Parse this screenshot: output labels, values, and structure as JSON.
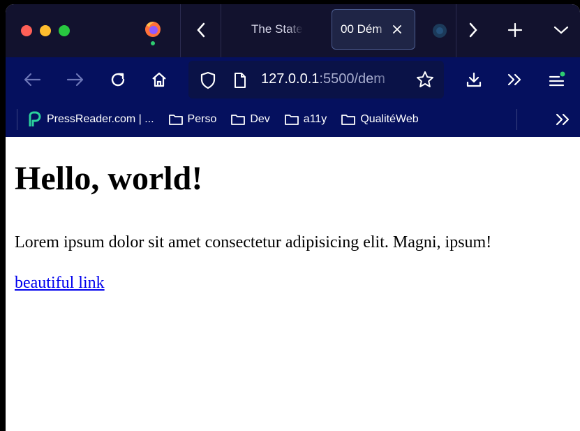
{
  "browser": {
    "tabs": [
      {
        "title": "The State",
        "active": false
      },
      {
        "title": "00 Dém",
        "active": true
      }
    ],
    "url": {
      "host": "127.0.0.1",
      "rest": ":5500/dem"
    },
    "bookmarks": [
      {
        "label": "PressReader.com | ...",
        "icon": "pressreader-icon"
      },
      {
        "label": "Perso",
        "icon": "folder-icon"
      },
      {
        "label": "Dev",
        "icon": "folder-icon"
      },
      {
        "label": "a11y",
        "icon": "folder-icon"
      },
      {
        "label": "QualitéWeb",
        "icon": "folder-icon"
      }
    ],
    "colors": {
      "tabbar": "#12122e",
      "navbar": "#05105e",
      "accent": "#2ecc71"
    }
  },
  "page": {
    "heading": "Hello, world!",
    "paragraph": "Lorem ipsum dolor sit amet consectetur adipisicing elit. Magni, ipsum!",
    "link": "beautiful link"
  }
}
